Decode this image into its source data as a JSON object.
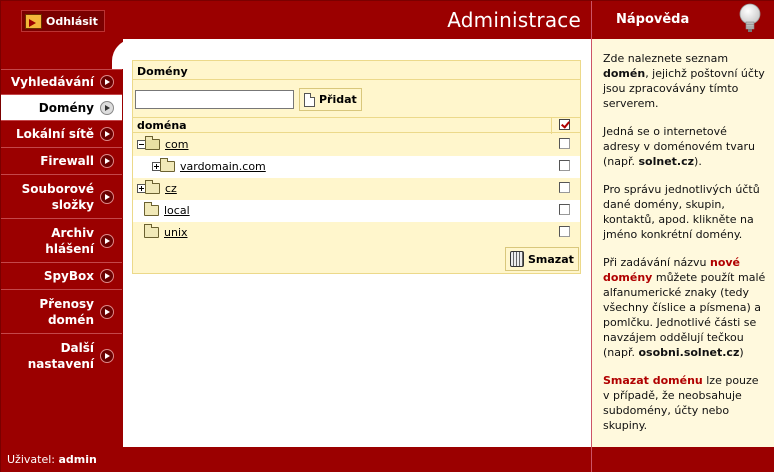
{
  "header": {
    "logout_label": "Odhlásit",
    "app_title": "Administrace"
  },
  "help_header": {
    "title": "Nápověda"
  },
  "sidebar": {
    "items": [
      {
        "label": "Vyhledávání",
        "active": false
      },
      {
        "label": "Domény",
        "active": true
      },
      {
        "label": "Lokální sítě",
        "active": false
      },
      {
        "label": "Firewall",
        "active": false
      },
      {
        "label": "Souborové složky",
        "active": false
      },
      {
        "label": "Archiv hlášení",
        "active": false
      },
      {
        "label": "SpyBox",
        "active": false
      },
      {
        "label": "Přenosy domén",
        "active": false
      },
      {
        "label": "Další nastavení",
        "active": false
      }
    ]
  },
  "panel": {
    "title": "Domény",
    "new_domain_value": "",
    "add_label": "Přidat",
    "delete_label": "Smazat",
    "column_header": "doména",
    "header_checked": true,
    "rows": [
      {
        "name": "com",
        "expander": "minus",
        "folder": "open",
        "checked": false
      },
      {
        "name": "vardomain.com",
        "expander": "plus",
        "folder": "closed",
        "checked": false
      },
      {
        "name": "cz",
        "expander": "plus",
        "folder": "closed",
        "checked": false
      },
      {
        "name": "local",
        "expander": "none",
        "folder": "closed",
        "checked": false
      },
      {
        "name": "unix",
        "expander": "none",
        "folder": "closed",
        "checked": false
      }
    ]
  },
  "help": {
    "p1_pre": "Zde naleznete seznam ",
    "p1_bold": "domén",
    "p1_post": ", jejichž poštovní účty jsou zpracovávány tímto serverem.",
    "p2_pre": "Jedná se o internetové adresy v doménovém tvaru (např. ",
    "p2_bold": "solnet.cz",
    "p2_post": ").",
    "p3": "Pro správu jednotlivých účtů dané domény, skupin, kontaktů, apod. klikněte na jméno konkrétní domény.",
    "p4_pre": "Při zadávání názvu ",
    "p4_red": "nové domény",
    "p4_mid": " můžete použít malé alfanumerické znaky (tedy všechny číslice a písmena) a pomlčku. Jednotlivé části se navzájem oddělují tečkou (např. ",
    "p4_bold": "osobni.solnet.cz",
    "p4_post": ")",
    "p5_red": "Smazat doménu",
    "p5_post": " lze pouze v případě, že neobsahuje subdomény, účty nebo skupiny."
  },
  "footer": {
    "user_label": "Uživatel:",
    "user_name": "admin"
  },
  "colors": {
    "brand": "#9b0000",
    "panel_bg": "#fff6cc",
    "help_bg": "#fff9dd",
    "accent_text": "#b00000"
  }
}
